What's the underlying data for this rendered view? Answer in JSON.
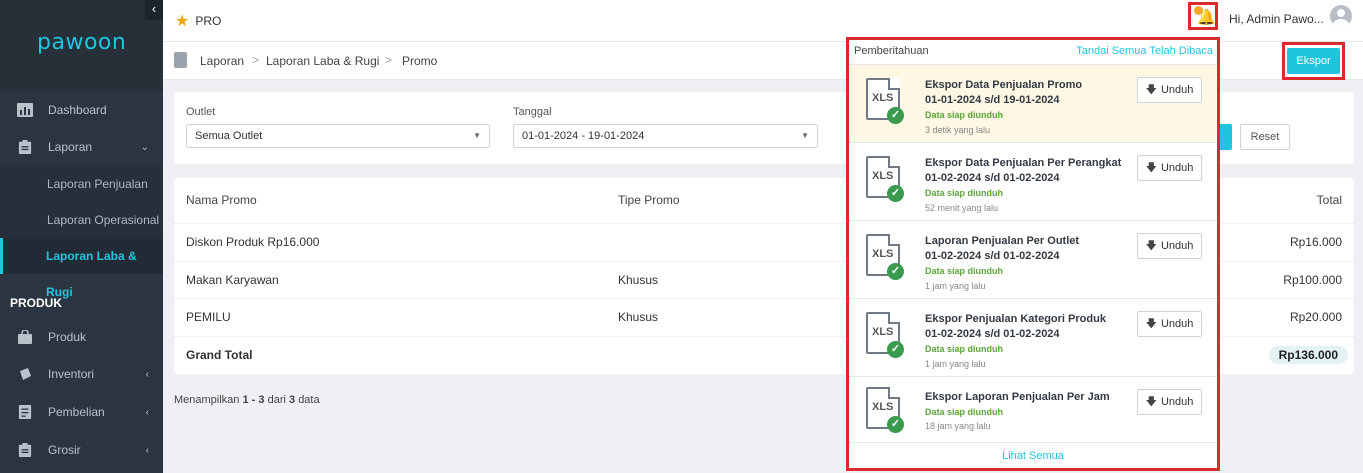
{
  "sidebar": {
    "logo": "pawoon",
    "collapse_icon": "‹",
    "items": [
      {
        "label": "Dashboard",
        "icon": "chart-icon"
      },
      {
        "label": "Laporan",
        "icon": "clipboard-icon",
        "chevron": "⌄"
      },
      {
        "label": "Laporan Penjualan"
      },
      {
        "label": "Laporan Operasional"
      },
      {
        "label": "Laporan Laba & Rugi"
      }
    ],
    "section": "PRODUK",
    "product_items": [
      {
        "label": "Produk",
        "icon": "bag-icon"
      },
      {
        "label": "Inventori",
        "icon": "box-icon",
        "chevron": "‹"
      },
      {
        "label": "Pembelian",
        "icon": "cart-icon",
        "chevron": "‹"
      },
      {
        "label": "Grosir",
        "icon": "clipboard-icon",
        "chevron": "‹"
      }
    ]
  },
  "topbar": {
    "plan": "PRO",
    "greeting": "Hi, Admin Pawo...",
    "notification_count": "1"
  },
  "breadcrumb": {
    "items": [
      "Laporan",
      "Laporan Laba & Rugi",
      "Promo"
    ],
    "separator": ">",
    "export_label": "Ekspor"
  },
  "filters": {
    "outlet_label": "Outlet",
    "outlet_value": "Semua Outlet",
    "date_label": "Tanggal",
    "date_value": "01-01-2024 - 19-01-2024",
    "reset_label": "Reset"
  },
  "table": {
    "headers": [
      "Nama Promo",
      "Tipe Promo",
      "Total"
    ],
    "rows": [
      {
        "name": "Diskon Produk Rp16.000",
        "type": "",
        "total": "Rp16.000"
      },
      {
        "name": "Makan Karyawan",
        "type": "Khusus",
        "total": "Rp100.000"
      },
      {
        "name": "PEMILU",
        "type": "Khusus",
        "total": "Rp20.000"
      }
    ],
    "grand_total_label": "Grand Total",
    "grand_total_value": "Rp136.000"
  },
  "pagination": {
    "prefix": "Menampilkan",
    "from": "1",
    "dash": "-",
    "to": "3",
    "of_label": "dari",
    "total": "3",
    "suffix": "data"
  },
  "notifications": {
    "title": "Pemberitahuan",
    "mark_all": "Tandai Semua Telah Dibaca",
    "see_all": "Lihat Semua",
    "download_label": "Unduh",
    "file_type": "XLS",
    "items": [
      {
        "title": "Ekspor Data Penjualan Promo",
        "range": "01-01-2024 s/d 19-01-2024",
        "status": "Data siap diunduh",
        "time": "3 detik yang lalu"
      },
      {
        "title": "Ekspor Data Penjualan Per Perangkat",
        "range": "01-02-2024 s/d 01-02-2024",
        "status": "Data siap diunduh",
        "time": "52 menit yang lalu"
      },
      {
        "title": "Laporan Penjualan Per Outlet",
        "range": "01-02-2024 s/d 01-02-2024",
        "status": "Data siap diunduh",
        "time": "1 jam yang lalu"
      },
      {
        "title": "Ekspor Penjualan Kategori Produk",
        "range": "01-02-2024 s/d 01-02-2024",
        "status": "Data siap diunduh",
        "time": "1 jam yang lalu"
      },
      {
        "title": "Ekspor Laporan Penjualan Per Jam",
        "range": "",
        "status": "Data siap diunduh",
        "time": "18 jam yang lalu"
      }
    ]
  },
  "colors": {
    "accent": "#20c4dd",
    "sidebar_bg": "#2b3541",
    "highlight": "#d92b2b",
    "success": "#5aa63a"
  }
}
